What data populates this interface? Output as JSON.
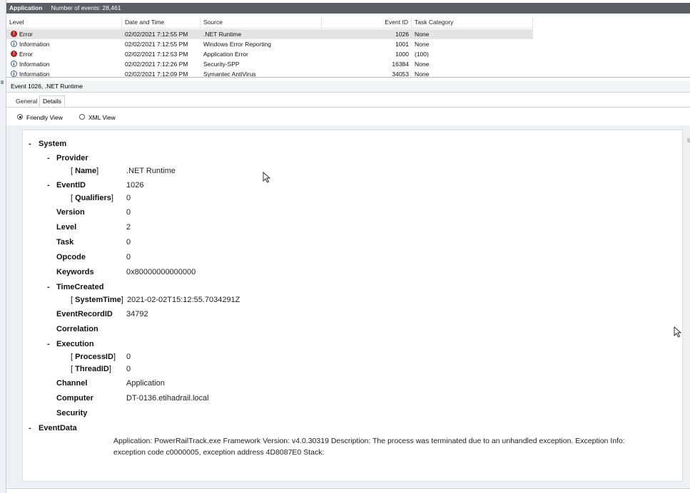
{
  "app": {
    "log_name": "Application",
    "event_count": "Number of events: 28,461"
  },
  "grid": {
    "columns": [
      "Level",
      "Date and Time",
      "Source",
      "Event ID",
      "Task Category"
    ],
    "rows": [
      {
        "level": "Error",
        "icon": "error-icon",
        "datetime": "02/02/2021 7:12:55 PM",
        "source": ".NET Runtime",
        "event_id": "1026",
        "task": "None",
        "selected": true
      },
      {
        "level": "Information",
        "icon": "info-icon",
        "datetime": "02/02/2021 7:12:55 PM",
        "source": "Windows Error Reporting",
        "event_id": "1001",
        "task": "None",
        "selected": false
      },
      {
        "level": "Error",
        "icon": "error-icon",
        "datetime": "02/02/2021 7:12:53 PM",
        "source": "Application Error",
        "event_id": "1000",
        "task": "(100)",
        "selected": false
      },
      {
        "level": "Information",
        "icon": "info-icon",
        "datetime": "02/02/2021 7:12:26 PM",
        "source": "Security-SPP",
        "event_id": "16384",
        "task": "None",
        "selected": false
      },
      {
        "level": "Information",
        "icon": "info-icon",
        "datetime": "02/02/2021 7:12:09 PM",
        "source": "Symantec AntiVirus",
        "event_id": "34053",
        "task": "None",
        "selected": false
      }
    ]
  },
  "details": {
    "header": "Event 1026, .NET Runtime",
    "tabs": {
      "general": "General",
      "details": "Details"
    },
    "views": {
      "friendly": "Friendly View",
      "xml": "XML View",
      "selected": "friendly"
    },
    "tree": {
      "system": "System",
      "provider": "Provider",
      "name_key": "Name",
      "name_val": ".NET Runtime",
      "eventid_key": "EventID",
      "eventid_val": "1026",
      "qualifiers_key": "Qualifiers",
      "qualifiers_val": "0",
      "version_key": "Version",
      "version_val": "0",
      "level_key": "Level",
      "level_val": "2",
      "task_key": "Task",
      "task_val": "0",
      "opcode_key": "Opcode",
      "opcode_val": "0",
      "keywords_key": "Keywords",
      "keywords_val": "0x80000000000000",
      "timecreated_key": "TimeCreated",
      "systemtime_key": "SystemTime",
      "systemtime_val": "2021-02-02T15:12:55.7034291Z",
      "eventrecordid_key": "EventRecordID",
      "eventrecordid_val": "34792",
      "correlation_key": "Correlation",
      "execution_key": "Execution",
      "processid_key": "ProcessID",
      "processid_val": "0",
      "threadid_key": "ThreadID",
      "threadid_val": "0",
      "channel_key": "Channel",
      "channel_val": "Application",
      "computer_key": "Computer",
      "computer_val": "DT-0136.etihadrail.local",
      "security_key": "Security",
      "eventdata_key": "EventData",
      "eventdata_line1": "Application: PowerRailTrack.exe Framework Version: v4.0.30319 Description: The process was terminated due to an unhandled exception. Exception Info:",
      "eventdata_line2": "exception code c0000005, exception address 4D8087E0 Stack:"
    }
  }
}
